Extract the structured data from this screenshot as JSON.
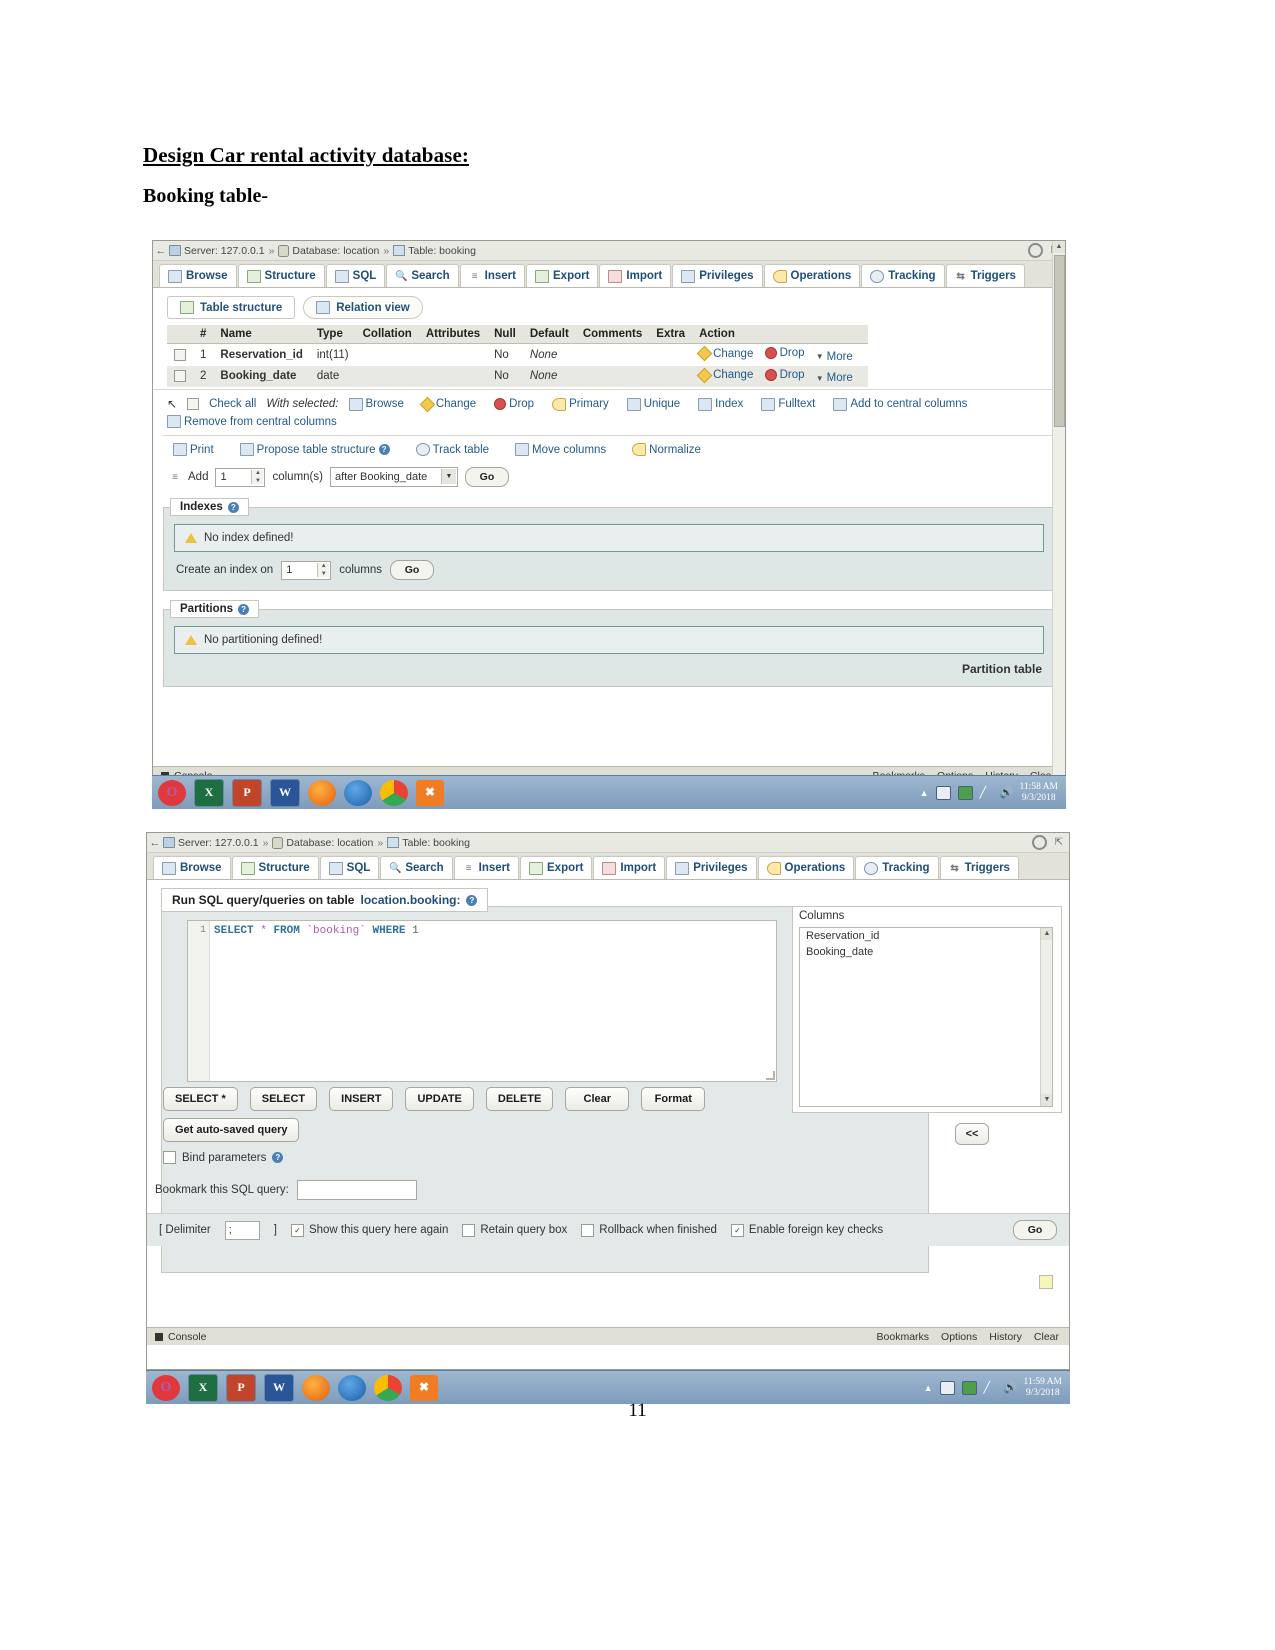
{
  "document": {
    "heading": "Design Car rental activity database:",
    "subheading": "Booking table-",
    "page_number": "11"
  },
  "window1": {
    "breadcrumb": {
      "server_label": "Server: 127.0.0.1",
      "database_label": "Database: location",
      "table_label": "Table: booking",
      "separator": "»"
    },
    "tabs": [
      {
        "label": "Browse",
        "icon": "browse-icon",
        "active": false
      },
      {
        "label": "Structure",
        "icon": "structure-icon",
        "active": true
      },
      {
        "label": "SQL",
        "icon": "sql-icon",
        "active": false
      },
      {
        "label": "Search",
        "icon": "search-icon",
        "active": false
      },
      {
        "label": "Insert",
        "icon": "insert-icon",
        "active": false
      },
      {
        "label": "Export",
        "icon": "export-icon",
        "active": false
      },
      {
        "label": "Import",
        "icon": "import-icon",
        "active": false
      },
      {
        "label": "Privileges",
        "icon": "privileges-icon",
        "active": false
      },
      {
        "label": "Operations",
        "icon": "operations-icon",
        "active": false
      },
      {
        "label": "Tracking",
        "icon": "tracking-icon",
        "active": false
      },
      {
        "label": "Triggers",
        "icon": "triggers-icon",
        "active": false
      }
    ],
    "subtabs": [
      {
        "label": "Table structure",
        "selected": true
      },
      {
        "label": "Relation view",
        "selected": false
      }
    ],
    "structure_table": {
      "headers": [
        "#",
        "Name",
        "Type",
        "Collation",
        "Attributes",
        "Null",
        "Default",
        "Comments",
        "Extra",
        "Action"
      ],
      "rows": [
        {
          "num": "1",
          "name": "Reservation_id",
          "type": "int(11)",
          "collation": "",
          "attributes": "",
          "null": "No",
          "default": "None",
          "comments": "",
          "extra": "",
          "actions": [
            "Change",
            "Drop",
            "More"
          ]
        },
        {
          "num": "2",
          "name": "Booking_date",
          "type": "date",
          "collation": "",
          "attributes": "",
          "null": "No",
          "default": "None",
          "comments": "",
          "extra": "",
          "actions": [
            "Change",
            "Drop",
            "More"
          ]
        }
      ]
    },
    "with_selected": {
      "check_all": "Check all",
      "label": "With selected:",
      "actions": [
        "Browse",
        "Change",
        "Drop",
        "Primary",
        "Unique",
        "Index",
        "Fulltext",
        "Add to central columns"
      ],
      "remove_link": "Remove from central columns"
    },
    "tools": [
      "Print",
      "Propose table structure",
      "Track table",
      "Move columns",
      "Normalize"
    ],
    "add_row": {
      "add_label": "Add",
      "count": "1",
      "columns_label": "column(s)",
      "position": "after Booking_date",
      "go_label": "Go"
    },
    "indexes": {
      "legend": "Indexes",
      "notice": "No index defined!",
      "create_label": "Create an index on",
      "create_count": "1",
      "columns_label": "columns",
      "go_label": "Go"
    },
    "partitions": {
      "legend": "Partitions",
      "notice": "No partitioning defined!",
      "button_label": "Partition table"
    },
    "console": {
      "label": "Console",
      "links": [
        "Bookmarks",
        "Options",
        "History",
        "Clear"
      ]
    },
    "taskbar": {
      "time": "11:58 AM",
      "date": "9/3/2018",
      "apps": [
        "opera-icon",
        "excel-icon",
        "powerpoint-icon",
        "word-icon",
        "firefox-icon",
        "thunderbird-icon",
        "chrome-icon",
        "xampp-icon"
      ]
    }
  },
  "window2": {
    "breadcrumb": {
      "server_label": "Server: 127.0.0.1",
      "database_label": "Database: location",
      "table_label": "Table: booking",
      "separator": "»"
    },
    "tabs": [
      {
        "label": "Browse",
        "icon": "browse-icon",
        "active": false
      },
      {
        "label": "Structure",
        "icon": "structure-icon",
        "active": false
      },
      {
        "label": "SQL",
        "icon": "sql-icon",
        "active": true
      },
      {
        "label": "Search",
        "icon": "search-icon",
        "active": false
      },
      {
        "label": "Insert",
        "icon": "insert-icon",
        "active": false
      },
      {
        "label": "Export",
        "icon": "export-icon",
        "active": false
      },
      {
        "label": "Import",
        "icon": "import-icon",
        "active": false
      },
      {
        "label": "Privileges",
        "icon": "privileges-icon",
        "active": false
      },
      {
        "label": "Operations",
        "icon": "operations-icon",
        "active": false
      },
      {
        "label": "Tracking",
        "icon": "tracking-icon",
        "active": false
      },
      {
        "label": "Triggers",
        "icon": "triggers-icon",
        "active": false
      }
    ],
    "run_label_prefix": "Run SQL query/queries on table",
    "run_label_table": "location.booking:",
    "editor": {
      "line_number": "1",
      "query_keyword1": "SELECT",
      "query_star": "*",
      "query_keyword2": "FROM",
      "query_table": "`booking`",
      "query_keyword3": "WHERE",
      "query_value": "1",
      "full_query": "SELECT * FROM `booking` WHERE 1"
    },
    "columns_panel": {
      "title": "Columns",
      "items": [
        "Reservation_id",
        "Booking_date"
      ],
      "collapse_label": "<<"
    },
    "query_buttons": [
      "SELECT *",
      "SELECT",
      "INSERT",
      "UPDATE",
      "DELETE",
      "Clear",
      "Format"
    ],
    "autosave_button": "Get auto-saved query",
    "bind_parameters_label": "Bind parameters",
    "bookmark_label": "Bookmark this SQL query:",
    "bookmark_value": "",
    "delimiter": {
      "open": "[ Delimiter",
      "value": ";",
      "close": "]"
    },
    "options": [
      {
        "label": "Show this query here again",
        "checked": true
      },
      {
        "label": "Retain query box",
        "checked": false
      },
      {
        "label": "Rollback when finished",
        "checked": false
      },
      {
        "label": "Enable foreign key checks",
        "checked": true
      }
    ],
    "go_label": "Go",
    "console": {
      "label": "Console",
      "links": [
        "Bookmarks",
        "Options",
        "History",
        "Clear"
      ]
    },
    "taskbar": {
      "time": "11:59 AM",
      "date": "9/3/2018",
      "apps": [
        "opera-icon",
        "excel-icon",
        "powerpoint-icon",
        "word-icon",
        "firefox-icon",
        "thunderbird-icon",
        "chrome-icon",
        "xampp-icon"
      ]
    }
  }
}
